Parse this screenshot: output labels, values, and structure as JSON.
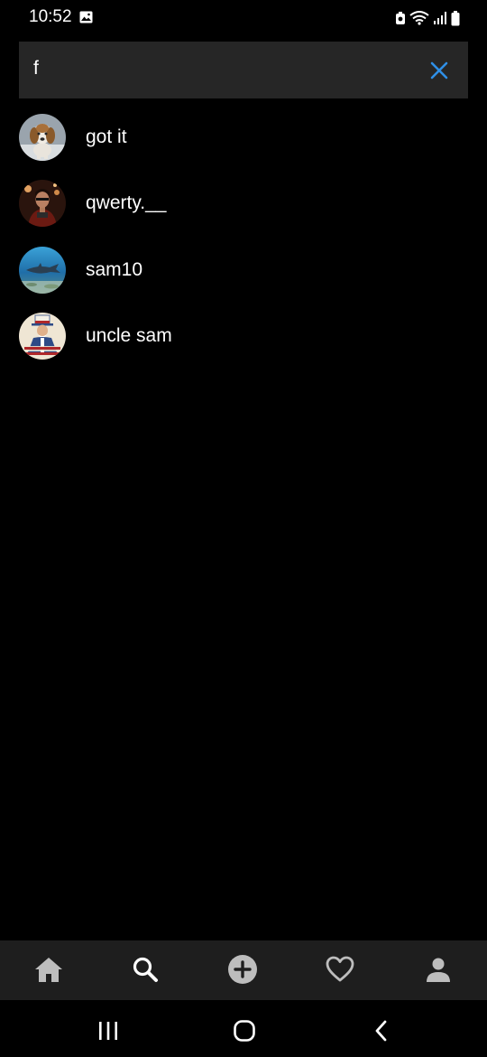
{
  "status_bar": {
    "time": "10:52",
    "icons": [
      "gallery-icon",
      "vpn-key-icon",
      "wifi-icon",
      "signal-icon",
      "battery-icon"
    ]
  },
  "search": {
    "value": "f",
    "placeholder": "",
    "clear_icon": "close-icon",
    "accent_color": "#2f8fe6"
  },
  "results": [
    {
      "name": "got it",
      "avatar": "beagle-puppy-photo"
    },
    {
      "name": "qwerty.__",
      "avatar": "man-portrait-photo"
    },
    {
      "name": "sam10",
      "avatar": "shark-underwater-photo"
    },
    {
      "name": "uncle sam",
      "avatar": "uncle-sam-poster"
    }
  ],
  "bottom_nav": {
    "items": [
      {
        "id": "home",
        "icon": "home-icon"
      },
      {
        "id": "search",
        "icon": "search-icon"
      },
      {
        "id": "add",
        "icon": "add-circle-icon"
      },
      {
        "id": "activity",
        "icon": "heart-icon"
      },
      {
        "id": "profile",
        "icon": "person-icon"
      }
    ],
    "background": "#1e1e1e",
    "icon_color": "#bdbdbd"
  },
  "system_nav": {
    "items": [
      "recent-apps-icon",
      "home-circle-icon",
      "back-icon"
    ]
  }
}
